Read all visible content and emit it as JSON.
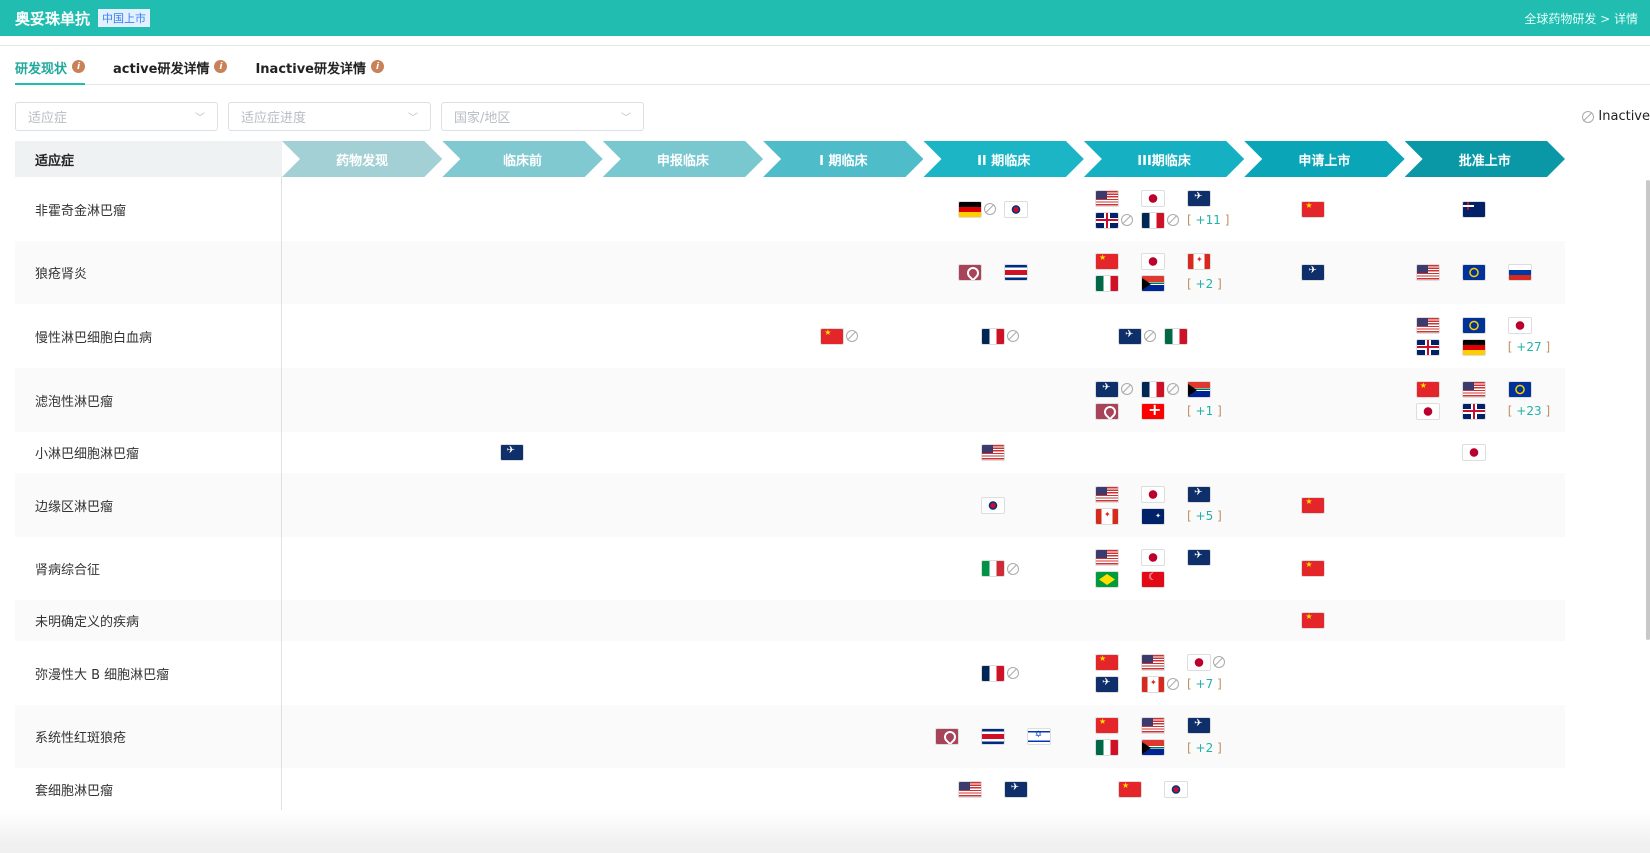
{
  "header": {
    "title": "奥妥珠单抗",
    "badge": "中国上市",
    "breadcrumb": "全球药物研发 > 详情"
  },
  "tabs": [
    {
      "label": "研发现状"
    },
    {
      "label": "active研发详情"
    },
    {
      "label": "Inactive研发详情"
    }
  ],
  "filters": [
    {
      "placeholder": "适应症"
    },
    {
      "placeholder": "适应症进度"
    },
    {
      "placeholder": "国家/地区"
    }
  ],
  "legend": {
    "inactive_label": "Inactive"
  },
  "table": {
    "indication_header": "适应症",
    "stages": [
      {
        "label": "药物发现",
        "color": "#a3d0d4"
      },
      {
        "label": "临床前",
        "color": "#80c9d0"
      },
      {
        "label": "申报临床",
        "color": "#79c7cf"
      },
      {
        "label": "I 期临床",
        "color": "#4fbcc9"
      },
      {
        "label": "II 期临床",
        "color": "#1cb5c6"
      },
      {
        "label": "III期临床",
        "color": "#15b0c2"
      },
      {
        "label": "申请上市",
        "color": "#0aa5b7"
      },
      {
        "label": "批准上市",
        "color": "#0a98a6"
      }
    ],
    "rows": [
      {
        "indication": "非霍奇金淋巴瘤",
        "h": 64,
        "cells": {
          "4": [
            {
              "f": "de",
              "x": 1
            },
            {
              "f": "kr"
            }
          ],
          "5": [
            {
              "f": "us"
            },
            {
              "f": "jp"
            },
            {
              "f": "ema"
            },
            {
              "f": "gb",
              "x": 1
            },
            {
              "f": "fr",
              "x": 1
            },
            {
              "more": "+11"
            }
          ],
          "6": [
            {
              "f": "cn"
            }
          ],
          "7": [
            {
              "f": "nz"
            }
          ]
        }
      },
      {
        "indication": "狼疮肾炎",
        "h": 63,
        "cells": {
          "4": [
            {
              "f": "pin"
            },
            {
              "f": "cr"
            }
          ],
          "5": [
            {
              "f": "cn"
            },
            {
              "f": "jp"
            },
            {
              "f": "ca"
            },
            {
              "f": "mx"
            },
            {
              "f": "za"
            },
            {
              "more": "+2"
            }
          ],
          "6": [
            {
              "f": "ema"
            }
          ],
          "7": [
            {
              "f": "us"
            },
            {
              "f": "eu"
            },
            {
              "f": "ru"
            }
          ]
        }
      },
      {
        "indication": "慢性淋巴细胞白血病",
        "h": 64,
        "cells": {
          "3": [
            {
              "f": "cn",
              "x": 1
            }
          ],
          "4": [
            {
              "f": "fr",
              "x": 1
            }
          ],
          "5": [
            {
              "f": "ema",
              "x": 1
            },
            {
              "f": "mx"
            }
          ],
          "7": [
            {
              "f": "us"
            },
            {
              "f": "eu"
            },
            {
              "f": "jp"
            },
            {
              "f": "gb"
            },
            {
              "f": "de"
            },
            {
              "more": "+27"
            }
          ]
        }
      },
      {
        "indication": "滤泡性淋巴瘤",
        "h": 64,
        "cells": {
          "5": [
            {
              "f": "ema",
              "x": 1
            },
            {
              "f": "fr",
              "x": 1
            },
            {
              "f": "za"
            },
            {
              "f": "pin"
            },
            {
              "f": "ch"
            },
            {
              "more": "+1"
            }
          ],
          "7": [
            {
              "f": "cn"
            },
            {
              "f": "us"
            },
            {
              "f": "eu"
            },
            {
              "f": "jp"
            },
            {
              "f": "gb"
            },
            {
              "more": "+23"
            }
          ]
        }
      },
      {
        "indication": "小淋巴细胞淋巴瘤",
        "h": 41,
        "cells": {
          "1": [
            {
              "f": "ema"
            }
          ],
          "4": [
            {
              "f": "us"
            }
          ],
          "7": [
            {
              "f": "jp"
            }
          ]
        }
      },
      {
        "indication": "边缘区淋巴瘤",
        "h": 64,
        "cells": {
          "4": [
            {
              "f": "kr"
            }
          ],
          "5": [
            {
              "f": "us"
            },
            {
              "f": "jp"
            },
            {
              "f": "ema"
            },
            {
              "f": "ca"
            },
            {
              "f": "au"
            },
            {
              "more": "+5"
            }
          ],
          "6": [
            {
              "f": "cn"
            }
          ]
        }
      },
      {
        "indication": "肾病综合征",
        "h": 63,
        "cells": {
          "4": [
            {
              "f": "it",
              "x": 1
            }
          ],
          "5": [
            {
              "f": "us"
            },
            {
              "f": "jp"
            },
            {
              "f": "ema"
            },
            {
              "f": "br"
            },
            {
              "f": "tr"
            }
          ],
          "6": [
            {
              "f": "cn"
            }
          ]
        }
      },
      {
        "indication": "未明确定义的疾病",
        "h": 41,
        "cells": {
          "6": [
            {
              "f": "cn"
            }
          ]
        }
      },
      {
        "indication": "弥漫性大 B 细胞淋巴瘤",
        "h": 64,
        "cells": {
          "4": [
            {
              "f": "fr",
              "x": 1
            }
          ],
          "5": [
            {
              "f": "cn"
            },
            {
              "f": "us"
            },
            {
              "f": "jp",
              "x": 1
            },
            {
              "f": "ema"
            },
            {
              "f": "ca",
              "x": 1
            },
            {
              "more": "+7"
            }
          ]
        }
      },
      {
        "indication": "系统性红斑狼疮",
        "h": 63,
        "cells": {
          "4": [
            {
              "f": "pin"
            },
            {
              "f": "cr"
            },
            {
              "f": "il"
            }
          ],
          "5": [
            {
              "f": "cn"
            },
            {
              "f": "us"
            },
            {
              "f": "ema"
            },
            {
              "f": "mx"
            },
            {
              "f": "za"
            },
            {
              "more": "+2"
            }
          ]
        }
      },
      {
        "indication": "套细胞淋巴瘤",
        "h": 42,
        "cells": {
          "4": [
            {
              "f": "us"
            },
            {
              "f": "ema"
            }
          ],
          "5": [
            {
              "f": "cn"
            },
            {
              "f": "kr"
            }
          ]
        }
      }
    ]
  }
}
